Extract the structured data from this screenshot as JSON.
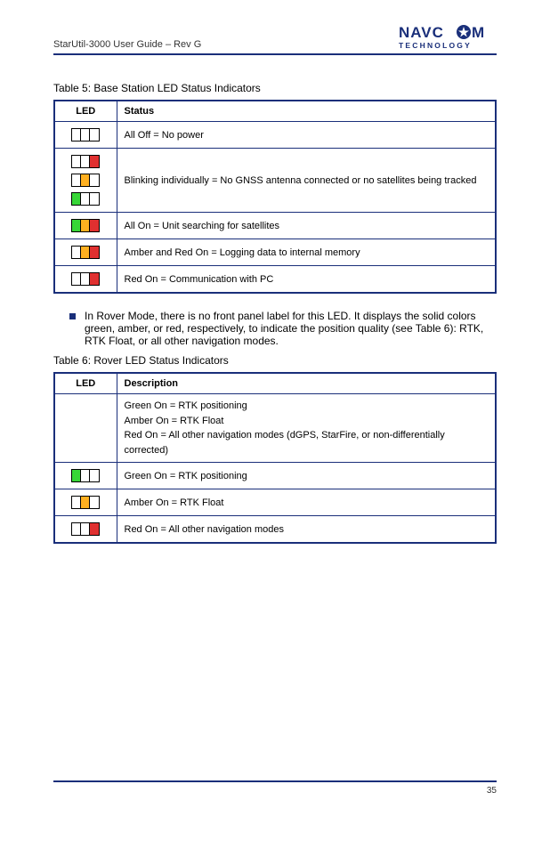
{
  "header": {
    "doc_title": "StarUtil-3000 User Guide – Rev G",
    "logo_main": "NAVCOM",
    "logo_sub": "TECHNOLOGY"
  },
  "table5": {
    "caption": "Table 5: Base Station LED Status Indicators",
    "head_led": "LED",
    "head_status": "Status",
    "rows": [
      {
        "icons": [
          [
            "off",
            "off",
            "off"
          ]
        ],
        "text": "All Off = No power"
      },
      {
        "icons": [
          [
            "off",
            "off",
            "red"
          ],
          [
            "off",
            "amber",
            "off"
          ],
          [
            "green",
            "off",
            "off"
          ]
        ],
        "text": "Blinking individually = No GNSS antenna connected or no satellites being tracked"
      },
      {
        "icons": [
          [
            "green",
            "amber",
            "red"
          ]
        ],
        "text": "All On = Unit searching for satellites"
      },
      {
        "icons": [
          [
            "off",
            "amber",
            "red"
          ]
        ],
        "text": "Amber and Red On = Logging data to internal memory"
      },
      {
        "icons": [
          [
            "off",
            "off",
            "red"
          ]
        ],
        "text": "Red On = Communication with PC"
      }
    ]
  },
  "standalone": {
    "text": "In Rover Mode, there is no front panel label for this LED. It displays the solid colors green, amber, or red, respectively, to indicate the position quality (see Table 6): RTK, RTK Float, or all other navigation modes."
  },
  "table6": {
    "caption": "Table 6: Rover LED Status Indicators",
    "head_led": "LED",
    "head_desc": "Description",
    "rows": [
      {
        "icons": null,
        "text": "Green On = RTK positioning\nAmber On = RTK Float\nRed On = All other navigation modes (dGPS, StarFire, or non-differentially corrected)"
      },
      {
        "icons": [
          [
            "green",
            "off",
            "off"
          ]
        ],
        "text": "Green On = RTK positioning"
      },
      {
        "icons": [
          [
            "off",
            "amber",
            "off"
          ]
        ],
        "text": "Amber On = RTK Float"
      },
      {
        "icons": [
          [
            "off",
            "off",
            "red"
          ]
        ],
        "text": "Red On = All other navigation modes"
      }
    ]
  },
  "footer": {
    "left": "",
    "right": "35"
  },
  "colors": {
    "border": "#1a2f7a"
  }
}
